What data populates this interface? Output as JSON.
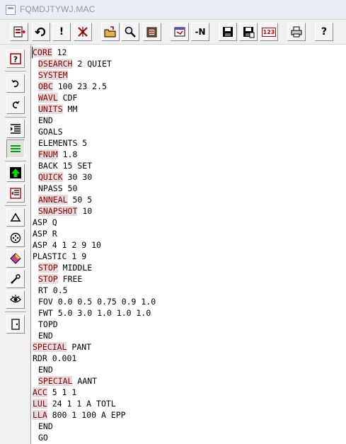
{
  "window": {
    "title": "FQMDJTYWJ.MAC"
  },
  "toolbar": {
    "buttons": [
      {
        "icon": "exit-icon"
      },
      {
        "icon": "refresh-icon"
      },
      {
        "icon": "exclamation-icon",
        "glyph": "!"
      },
      {
        "icon": "cross-icon"
      },
      {
        "icon": "open-file-icon"
      },
      {
        "icon": "magnifier-icon"
      },
      {
        "icon": "clipboard-icon"
      },
      {
        "icon": "edit-window-icon"
      },
      {
        "icon": "minus-n-icon",
        "glyph": "-N"
      },
      {
        "icon": "save-icon"
      },
      {
        "icon": "save-as-icon"
      },
      {
        "icon": "line-numbers-icon",
        "glyph": "123"
      },
      {
        "icon": "print-icon"
      },
      {
        "icon": "help-icon",
        "glyph": "?"
      }
    ]
  },
  "colors": {
    "keyword_text": "#8b0000",
    "keyword_bg": "#e4dcdc",
    "toolbar_red": "#c00000"
  },
  "editor": {
    "lines": [
      {
        "kw": "CORE",
        "rest": " 12",
        "indent": false
      },
      {
        "kw": "DSEARCH",
        "rest": " 2 QUIET",
        "indent": true
      },
      {
        "kw": "SYSTEM",
        "rest": "",
        "indent": true
      },
      {
        "kw": "OBC",
        "rest": " 100 23 2.5",
        "indent": true
      },
      {
        "kw": "WAVL",
        "rest": " CDF",
        "indent": true
      },
      {
        "kw": "UNITS",
        "rest": " MM",
        "indent": true
      },
      {
        "kw": "",
        "rest": "END",
        "indent": true
      },
      {
        "kw": "",
        "rest": "GOALS",
        "indent": true
      },
      {
        "kw": "",
        "rest": "ELEMENTS 5",
        "indent": true
      },
      {
        "kw": "FNUM",
        "rest": " 1.8",
        "indent": true
      },
      {
        "kw": "",
        "rest": "BACK 15 SET",
        "indent": true
      },
      {
        "kw": "QUICK",
        "rest": " 30 30",
        "indent": true
      },
      {
        "kw": "",
        "rest": "NPASS 50",
        "indent": true
      },
      {
        "kw": "ANNEAL",
        "rest": " 50 5",
        "indent": true
      },
      {
        "kw": "SNAPSHOT",
        "rest": " 10",
        "indent": true
      },
      {
        "kw": "",
        "rest": "ASP Q",
        "indent": false
      },
      {
        "kw": "",
        "rest": "ASP R",
        "indent": false
      },
      {
        "kw": "",
        "rest": "ASP 4 1 2 9 10",
        "indent": false
      },
      {
        "kw": "",
        "rest": "PLASTIC 1 9",
        "indent": false
      },
      {
        "kw": "STOP",
        "rest": " MIDDLE",
        "indent": true
      },
      {
        "kw": "STOP",
        "rest": " FREE",
        "indent": true
      },
      {
        "kw": "",
        "rest": "RT 0.5",
        "indent": true
      },
      {
        "kw": "",
        "rest": "FOV 0.0 0.5 0.75 0.9 1.0",
        "indent": true
      },
      {
        "kw": "",
        "rest": "FWT 5.0 3.0 1.0 1.0 1.0",
        "indent": true
      },
      {
        "kw": "",
        "rest": "TOPD",
        "indent": true
      },
      {
        "kw": "",
        "rest": "END",
        "indent": true
      },
      {
        "kw": "SPECIAL",
        "rest": " PANT",
        "indent": false
      },
      {
        "kw": "",
        "rest": "RDR 0.001",
        "indent": false
      },
      {
        "kw": "",
        "rest": "END",
        "indent": true
      },
      {
        "kw": "SPECIAL",
        "rest": " AANT",
        "indent": true
      },
      {
        "kw": "ACC",
        "rest": " 5 1 1",
        "indent": false
      },
      {
        "kw": "LUL",
        "rest": " 24 1 1 A TOTL",
        "indent": false
      },
      {
        "kw": "LLA",
        "rest": " 800 1 100 A EPP",
        "indent": false
      },
      {
        "kw": "",
        "rest": "END",
        "indent": true
      },
      {
        "kw": "",
        "rest": "GO",
        "indent": true
      }
    ]
  }
}
